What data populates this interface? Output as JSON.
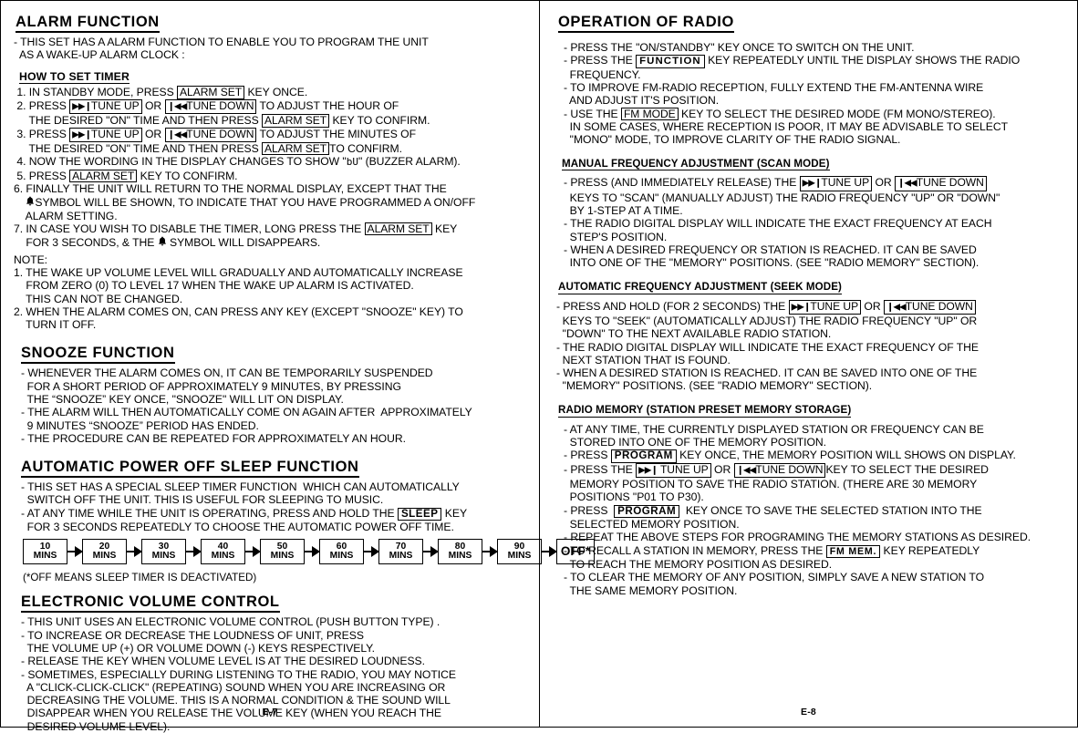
{
  "document": {
    "left_page_number": "E-7",
    "right_page_number": "E-8"
  },
  "keys": {
    "alarm_set": "ALARM SET",
    "tune_up": "TUNE UP",
    "tune_down": "TUNE DOWN",
    "sleep": "SLEEP",
    "function": "FUNCTION",
    "fm_mode": "FM MODE",
    "program": "PROGRAM",
    "fm_mem": "FM MEM.",
    "arrow_up_glyph": "▶▶❙",
    "arrow_down_glyph": "❙◀◀",
    "bell_glyph": "🔔",
    "buzzer_glyph": "bU"
  },
  "left": {
    "alarm_function": {
      "title": "ALARM FUNCTION",
      "intro": [
        "- THIS SET HAS A ALARM FUNCTION TO ENABLE YOU TO PROGRAM THE UNIT",
        "  AS A WAKE-UP ALARM CLOCK :"
      ],
      "how_to_set_timer": {
        "title": "HOW TO SET TIMER",
        "steps": [
          {
            "pre": " 1. IN STANDBY MODE, PRESS ",
            "key": "ALARM SET",
            "post": " KEY ONCE."
          },
          {
            "pre": " 2. PRESS ",
            "key_up": "TUNE UP",
            "mid": " OR ",
            "key_down": "TUNE DOWN",
            "post": " TO ADJUST THE HOUR OF"
          },
          {
            "cont": "     THE DESIRED \"ON\" TIME AND THEN PRESS ",
            "key": "ALARM SET",
            "post": " KEY TO CONFIRM."
          },
          {
            "pre": " 3. PRESS ",
            "key_up": "TUNE UP",
            "mid": " OR ",
            "key_down": "TUNE DOWN",
            "post": " TO ADJUST THE MINUTES OF"
          },
          {
            "cont": "     THE DESIRED \"ON\" TIME AND THEN PRESS ",
            "key": "ALARM SET",
            "post": "TO CONFIRM."
          },
          {
            "plain_pre": " 4. NOW THE WORDING IN THE DISPLAY CHANGES TO SHOW \"",
            "seg": "bU",
            "plain_post": "\" (BUZZER ALARM)."
          },
          {
            "pre": " 5. PRESS ",
            "key": "ALARM SET",
            "post": " KEY TO CONFIRM."
          },
          {
            "plain": "6. FINALLY THE UNIT WILL RETURN TO THE NORMAL DISPLAY, EXCEPT THAT THE"
          },
          {
            "bell_pre": "    ",
            "bell": true,
            "bell_post": "SYMBOL WILL BE SHOWN, TO INDICATE THAT YOU HAVE PROGRAMMED A ON/OFF"
          },
          {
            "plain": "    ALARM SETTING."
          },
          {
            "pre": "7. IN CASE YOU WISH TO DISABLE THE TIMER, LONG PRESS THE ",
            "key": "ALARM SET",
            "post": " KEY"
          },
          {
            "bell_pre": "    FOR 3 SECONDS, & THE ",
            "bell": true,
            "bell_post": " SYMBOL WILL DISAPPEARS."
          }
        ]
      },
      "note": {
        "title": "NOTE:",
        "items": [
          "1. THE WAKE UP VOLUME LEVEL WILL GRADUALLY AND AUTOMATICALLY INCREASE",
          "    FROM ZERO (0) TO LEVEL 17 WHEN THE WAKE UP ALARM IS ACTIVATED.",
          "    THIS CAN NOT BE CHANGED.",
          "2. WHEN THE ALARM COMES ON, CAN PRESS ANY KEY (EXCEPT \"SNOOZE\" KEY) TO",
          "    TURN IT OFF."
        ]
      }
    },
    "snooze_function": {
      "title": "SNOOZE FUNCTION",
      "lines": [
        "- WHENEVER THE ALARM COMES ON, IT CAN BE TEMPORARILY SUSPENDED",
        "  FOR A SHORT PERIOD OF APPROXIMATELY 9 MINUTES, BY PRESSING",
        "  THE “SNOOZE” KEY ONCE, \"SNOOZE\" WILL LIT ON DISPLAY.",
        "- THE ALARM WILL THEN AUTOMATICALLY COME ON AGAIN AFTER  APPROXIMATELY",
        "  9 MINUTES “SNOOZE” PERIOD HAS ENDED.",
        "- THE PROCEDURE CAN BE REPEATED FOR APPROXIMATELY AN HOUR."
      ]
    },
    "sleep_function": {
      "title": "AUTOMATIC POWER OFF SLEEP FUNCTION",
      "lines_before": [
        "- THIS SET HAS A SPECIAL SLEEP TIMER FUNCTION  WHICH CAN AUTOMATICALLY",
        "  SWITCH OFF THE UNIT. THIS IS USEFUL FOR SLEEPING TO MUSIC."
      ],
      "sleep_line": {
        "pre": "- AT ANY TIME WHILE THE UNIT IS OPERATING, PRESS AND HOLD THE ",
        "key": "SLEEP",
        "post": " KEY"
      },
      "sleep_line_cont": "  FOR 3 SECONDS REPEATEDLY TO CHOOSE THE AUTOMATIC POWER OFF TIME.",
      "flow_steps": [
        {
          "top": "10",
          "bottom": "MINS"
        },
        {
          "top": "20",
          "bottom": "MINS"
        },
        {
          "top": "30",
          "bottom": "MINS"
        },
        {
          "top": "40",
          "bottom": "MINS"
        },
        {
          "top": "50",
          "bottom": "MINS"
        },
        {
          "top": "60",
          "bottom": "MINS"
        },
        {
          "top": "70",
          "bottom": "MINS"
        },
        {
          "top": "80",
          "bottom": "MINS"
        },
        {
          "top": "90",
          "bottom": "MINS"
        }
      ],
      "flow_end": "OFF*",
      "footnote": "(*OFF MEANS SLEEP TIMER IS DEACTIVATED)"
    },
    "volume_control": {
      "title": "ELECTRONIC VOLUME CONTROL",
      "lines": [
        "- THIS UNIT USES AN ELECTRONIC VOLUME CONTROL (PUSH BUTTON TYPE) .",
        "- TO INCREASE OR DECREASE THE LOUDNESS OF UNIT, PRESS",
        "  THE VOLUME UP (+) OR VOLUME DOWN (-) KEYS RESPECTIVELY.",
        "- RELEASE THE KEY WHEN VOLUME LEVEL IS AT THE DESIRED LOUDNESS.",
        "- SOMETIMES, ESPECIALLY DURING LISTENING TO THE RADIO, YOU MAY NOTICE",
        "  A \"CLICK-CLICK-CLICK\" (REPEATING) SOUND WHEN YOU ARE INCREASING OR",
        "  DECREASING THE VOLUME. THIS IS A NORMAL CONDITION & THE SOUND WILL",
        "  DISAPPEAR WHEN YOU RELEASE THE VOLUME KEY (WHEN YOU REACH THE",
        "  DESIRED VOLUME LEVEL)."
      ]
    }
  },
  "right": {
    "operation_of_radio": {
      "title": "OPERATION OF RADIO",
      "l1": "- PRESS THE \"ON/STANDBY\" KEY ONCE TO SWITCH ON THE UNIT.",
      "l2_pre": "- PRESS THE ",
      "l2_key": "FUNCTION",
      "l2_post": " KEY REPEATEDLY UNTIL THE DISPLAY SHOWS THE RADIO",
      "l3": "  FREQUENCY.",
      "l4": "- TO IMPROVE FM-RADIO RECEPTION, FULLY EXTEND THE FM-ANTENNA WIRE",
      "l5": "  AND ADJUST IT'S POSITION.",
      "l6_pre": "- USE THE ",
      "l6_key": "FM MODE",
      "l6_post": " KEY TO SELECT THE DESIRED MODE (FM MONO/STEREO).",
      "l7": "  IN SOME CASES, WHERE RECEPTION IS POOR, IT MAY BE ADVISABLE TO SELECT",
      "l8": "  \"MONO\" MODE, TO IMPROVE CLARITY OF THE RADIO SIGNAL."
    },
    "scan_mode": {
      "title": "MANUAL FREQUENCY ADJUSTMENT (SCAN MODE)",
      "l1_pre": "- PRESS (AND IMMEDIATELY RELEASE) THE ",
      "l1_up": "TUNE UP",
      "l1_mid": " OR ",
      "l1_down": "TUNE DOWN",
      "l2": "  KEYS TO \"SCAN\" (MANUALLY ADJUST) THE RADIO FREQUENCY \"UP\" OR \"DOWN\"",
      "l3": "  BY 1-STEP AT A TIME.",
      "l4": "- THE RADIO DIGITAL DISPLAY WILL INDICATE THE EXACT FREQUENCY AT EACH",
      "l5": "  STEP'S POSITION.",
      "l6": "- WHEN A DESIRED FREQUENCY OR STATION IS REACHED. IT CAN BE SAVED",
      "l7": "  INTO ONE OF THE \"MEMORY\" POSITIONS. (SEE \"RADIO MEMORY\" SECTION)."
    },
    "seek_mode": {
      "title": "AUTOMATIC FREQUENCY ADJUSTMENT (SEEK MODE)",
      "l1_pre": "- PRESS AND HOLD (FOR 2 SECONDS) THE ",
      "l1_up": "TUNE UP",
      "l1_mid": " OR ",
      "l1_down": "TUNE DOWN",
      "l2": "  KEYS TO \"SEEK\" (AUTOMATICALLY ADJUST) THE RADIO FREQUENCY \"UP\" OR",
      "l3": "  \"DOWN\" TO THE NEXT AVAILABLE RADIO STATION.",
      "l4": "- THE RADIO DIGITAL DISPLAY WILL INDICATE THE EXACT FREQUENCY OF THE",
      "l5": "  NEXT STATION THAT IS FOUND.",
      "l6": "- WHEN A DESIRED STATION IS REACHED. IT CAN BE SAVED INTO ONE OF THE",
      "l7": "  \"MEMORY\" POSITIONS. (SEE \"RADIO MEMORY\" SECTION)."
    },
    "radio_memory": {
      "title": "RADIO MEMORY (STATION PRESET MEMORY STORAGE)",
      "l1": "- AT ANY TIME, THE CURRENTLY DISPLAYED STATION OR FREQUENCY CAN BE",
      "l2": "  STORED INTO ONE OF THE MEMORY POSITION.",
      "l3_pre": "- PRESS ",
      "l3_key": "PROGRAM",
      "l3_post": " KEY ONCE, THE MEMORY POSITION WILL SHOWS ON DISPLAY.",
      "l4_pre": "- PRESS THE ",
      "l4_up": " TUNE UP",
      "l4_mid": " OR ",
      "l4_down": "TUNE DOWN",
      "l4_post": "KEY TO SELECT THE DESIRED",
      "l5": "  MEMORY POSITION TO SAVE THE RADIO STATION. (THERE ARE 30 MEMORY",
      "l6": "  POSITIONS \"P01 TO P30).",
      "l7_pre": "- PRESS  ",
      "l7_key": "PROGRAM",
      "l7_post": "  KEY ONCE TO SAVE THE SELECTED STATION INTO THE",
      "l8": "  SELECTED MEMORY POSITION.",
      "l9": "- REPEAT THE ABOVE STEPS FOR PROGRAMING THE MEMORY STATIONS AS DESIRED.",
      "l10_pre": "- TO RECALL A STATION IN MEMORY, PRESS THE ",
      "l10_key": "FM MEM.",
      "l10_post": " KEY REPEATEDLY",
      "l11": "  TO REACH THE MEMORY POSITION AS DESIRED.",
      "l12": "- TO CLEAR THE MEMORY OF ANY POSITION, SIMPLY SAVE A NEW STATION TO",
      "l13": "  THE SAME MEMORY POSITION."
    }
  }
}
